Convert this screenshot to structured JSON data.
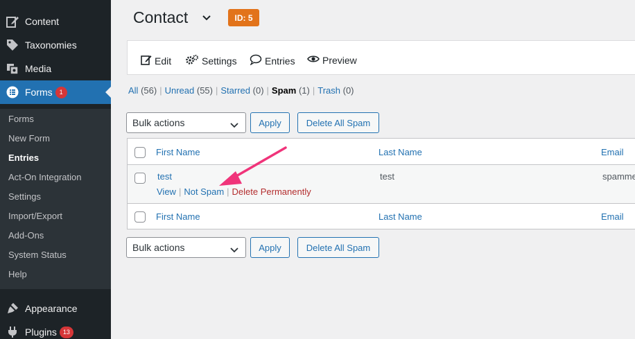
{
  "sidebar": {
    "top_items": [
      {
        "label": "Content",
        "icon": "edit-icon"
      },
      {
        "label": "Taxonomies",
        "icon": "tag-icon"
      },
      {
        "label": "Media",
        "icon": "media-icon"
      },
      {
        "label": "Forms",
        "icon": "forms-icon",
        "badge": "1"
      }
    ],
    "sub_items": [
      "Forms",
      "New Form",
      "Entries",
      "Act-On Integration",
      "Settings",
      "Import/Export",
      "Add-Ons",
      "System Status",
      "Help"
    ],
    "bottom_items": [
      {
        "label": "Appearance",
        "icon": "brush-icon"
      },
      {
        "label": "Plugins",
        "icon": "plugin-icon",
        "badge": "13"
      }
    ],
    "colors": {
      "background": "#1d2327",
      "active": "#2271b1",
      "submenu": "#2c3338"
    }
  },
  "header": {
    "title": "Contact",
    "id_badge": "ID: 5",
    "badge_color": "#e2731a"
  },
  "toolbar": {
    "edit": "Edit",
    "settings": "Settings",
    "entries": "Entries",
    "preview": "Preview"
  },
  "filters": {
    "all": "All",
    "all_count": "(56)",
    "unread": "Unread",
    "unread_count": "(55)",
    "starred": "Starred",
    "starred_count": "(0)",
    "spam": "Spam",
    "spam_count": "(1)",
    "trash": "Trash",
    "trash_count": "(0)"
  },
  "bulk": {
    "select": "Bulk actions",
    "apply": "Apply",
    "delete_all_spam": "Delete All Spam"
  },
  "table": {
    "columns": {
      "first_name": "First Name",
      "last_name": "Last Name",
      "email": "Email"
    },
    "rows": [
      {
        "first_name": "test",
        "last_name": "test",
        "email": "spamme"
      }
    ],
    "row_actions": {
      "view": "View",
      "not_spam": "Not Spam",
      "delete_permanently": "Delete Permanently"
    }
  },
  "annotation_color": "#f0347a"
}
